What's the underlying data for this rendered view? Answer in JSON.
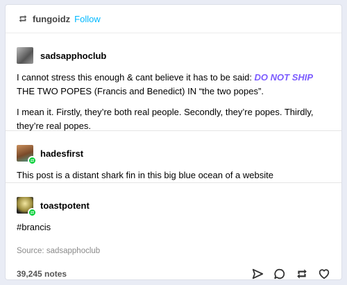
{
  "header": {
    "username": "fungoidz",
    "follow_label": "Follow"
  },
  "posts": [
    {
      "username": "sadsapphoclub",
      "text1_before": "I cannot stress this enough & cant believe it has to be said: ",
      "text1_emphasis": "DO NOT SHIP",
      "text1_after": " THE TWO POPES (Francis and Benedict) IN “the two popes”.",
      "text2": "I mean it. Firstly, they’re both real people. Secondly, they’re popes. Thirdly, they’re real popes."
    },
    {
      "username": "hadesfirst",
      "text": "This post is a distant shark fin in this big blue ocean of a website"
    },
    {
      "username": "toastpotent",
      "text": "#brancis"
    }
  ],
  "source": "Source: sadsapphoclub",
  "notes": "39,245 notes",
  "icons": [
    "reblog-icon",
    "share-icon",
    "reply-icon",
    "reblog-action-icon",
    "like-icon"
  ],
  "colors": {
    "follow": "#00b8ff",
    "emphasis": "#7c5cff",
    "reblog_badge": "#00cf35"
  }
}
